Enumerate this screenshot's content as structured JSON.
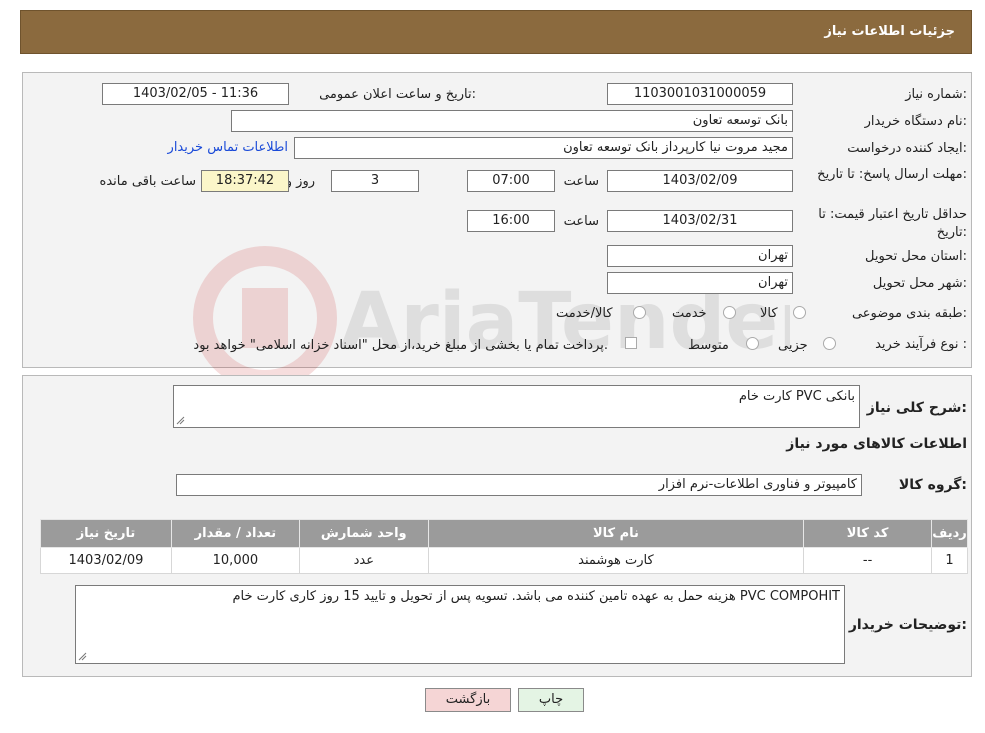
{
  "header": {
    "title": "جزئیات اطلاعات نیاز"
  },
  "form": {
    "need_number_label": "شماره نیاز:",
    "need_number": "1103001031000059",
    "announce_datetime_label": "تاریخ و ساعت اعلان عمومی:",
    "announce_datetime": "1403/02/05 - 11:36",
    "buyer_org_label": "نام دستگاه خریدار:",
    "buyer_org": "بانک توسعه تعاون",
    "requester_label": "ایجاد کننده درخواست:",
    "requester": "مجید مروت نیا کارپرداز بانک توسعه تعاون",
    "buyer_contact_link": "اطلاعات تماس خریدار",
    "reply_deadline_label": "مهلت ارسال پاسخ: تا تاریخ:",
    "reply_deadline_date": "1403/02/09",
    "time_label": "ساعت",
    "reply_deadline_time": "07:00",
    "days_value": "3",
    "days_label": "روز و",
    "remaining_time": "18:37:42",
    "remaining_label": "ساعت باقی مانده",
    "price_validity_label": "حداقل تاریخ اعتبار قیمت: تا تاریخ:",
    "price_validity_date": "1403/02/31",
    "price_validity_time": "16:00",
    "province_label": "استان محل تحویل:",
    "province": "تهران",
    "city_label": "شهر محل تحویل:",
    "city": "تهران",
    "category_label": "طبقه بندی موضوعی:",
    "category_options": [
      "کالا",
      "خدمت",
      "کالا/خدمت"
    ],
    "purchase_type_label": "نوع فرآیند خرید :",
    "purchase_type_options": [
      "جزیی",
      "متوسط"
    ],
    "payment_note": "پرداخت تمام یا بخشی از مبلغ خرید،از محل \"اسناد خزانه اسلامی\" خواهد بود."
  },
  "details": {
    "description_label": "شرح کلی نیاز:",
    "description": "کارت خام PVC بانکی",
    "goods_info_title": "اطلاعات کالاهای مورد نیاز",
    "goods_group_label": "گروه کالا:",
    "goods_group": "کامپیوتر و فناوری اطلاعات-نرم افزار",
    "table": {
      "headers": [
        "ردیف",
        "کد کالا",
        "نام کالا",
        "واحد شمارش",
        "تعداد / مقدار",
        "تاریخ نیاز"
      ],
      "rows": [
        [
          "1",
          "--",
          "کارت هوشمند",
          "عدد",
          "10,000",
          "1403/02/09"
        ]
      ]
    },
    "buyer_notes_label": "توضیحات خریدار:",
    "buyer_notes": "هزینه حمل به عهده تامین کننده می باشد. تسویه پس از تحویل و تایید 15 روز کاری کارت خام PVC COMPOHIT"
  },
  "buttons": {
    "print": "چاپ",
    "back": "بازگشت"
  },
  "watermark": {
    "text": "AriaTender.neT"
  },
  "colors": {
    "header_bg": "#8b6a3e",
    "table_header_bg": "#9b9b9b",
    "link": "#1a4ad8"
  }
}
